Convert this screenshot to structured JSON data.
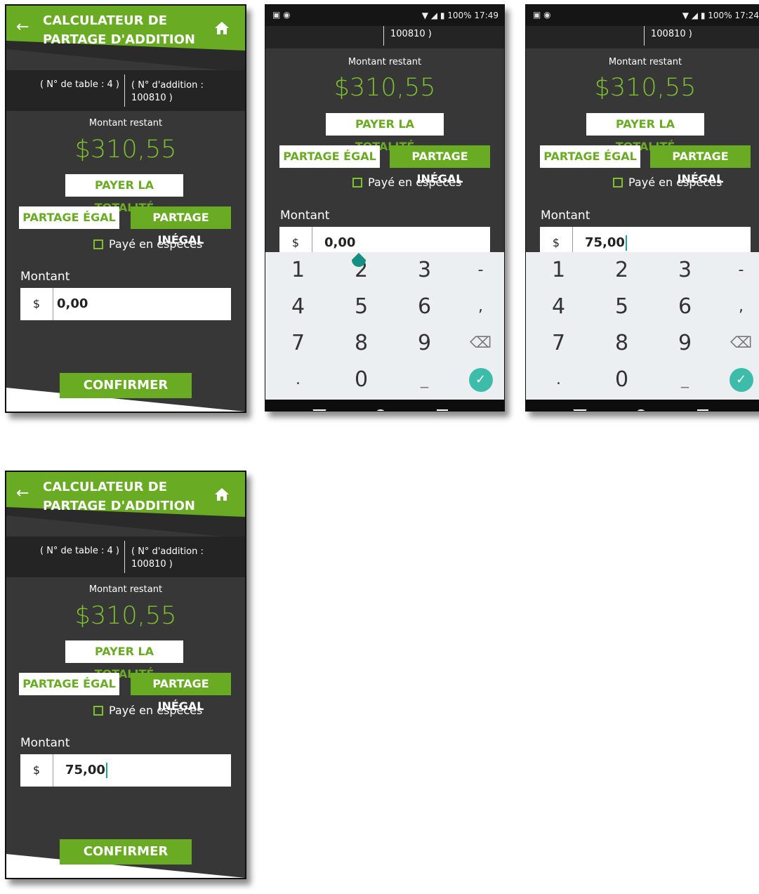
{
  "header": {
    "back_icon": "arrow-left-icon",
    "title_line1": "CALCULATEUR DE",
    "title_line2": "PARTAGE D'ADDITION",
    "home_icon": "home-icon"
  },
  "info": {
    "table": "( N° de table : 4 )",
    "addition_line1": "( N° d'addition :",
    "addition_line2": "100810 )"
  },
  "remaining_label": "Montant restant",
  "remaining_amount": "$310,55",
  "buttons": {
    "pay_all": "PAYER LA TOTALITÉ",
    "equal_split": "PARTAGE ÉGAL",
    "unequal_split": "PARTAGE INÉGAL",
    "confirm": "CONFIRMER"
  },
  "cash_label": "Payé en espèces",
  "amount_label": "Montant",
  "currency": "$",
  "screens": {
    "s1": {
      "amount_value": "0,00"
    },
    "s2": {
      "amount_value": "0,00",
      "time": "17:49",
      "battery": "100%"
    },
    "s3": {
      "amount_value": "75,00",
      "time": "17:24",
      "battery": "100%"
    },
    "s4": {
      "amount_value": "75,00"
    }
  },
  "keypad": {
    "keys": [
      "1",
      "2",
      "3",
      "-",
      "4",
      "5",
      "6",
      ",",
      "7",
      "8",
      "9",
      "⌫",
      ".",
      "0",
      "_",
      "✓"
    ]
  },
  "colors": {
    "brand_green": "#6aab24",
    "amount_green": "#7cc12e",
    "background": "#373737",
    "info_bar": "#242424",
    "accent_teal": "#18a89b"
  }
}
